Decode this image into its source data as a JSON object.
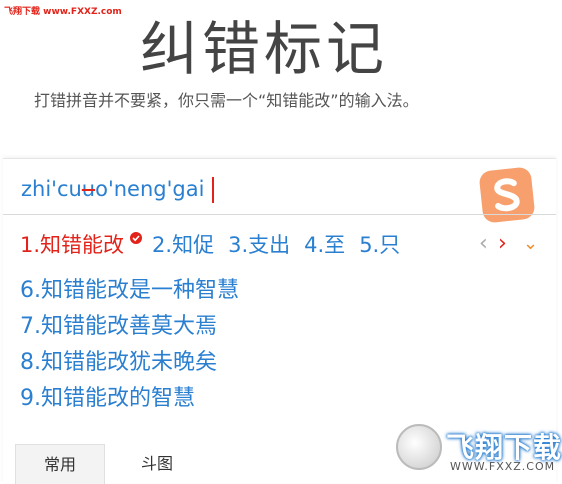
{
  "watermark_top": "飞翔下载 www.FXXZ.com",
  "title": "纠错标记",
  "subtitle": "打错拼音并不要紧，你只需一个“知错能改”的输入法。",
  "ime": {
    "pinyin": {
      "before": "zhi'cu",
      "struck": "u",
      "after": "o'neng'gai"
    },
    "logo_icon": "sogou-s-logo",
    "candidates": [
      {
        "label": "1.知错能改",
        "selected": true
      },
      {
        "label": "2.知促"
      },
      {
        "label": "3.支出"
      },
      {
        "label": "4.至"
      },
      {
        "label": "5.只"
      }
    ],
    "nav": {
      "prev": "‹",
      "next": "›",
      "expand": "⌄"
    },
    "list": [
      "6.知错能改是一种智慧",
      "7.知错能改善莫大焉",
      "8.知错能改犹未晚矣",
      "9.知错能改的智慧"
    ],
    "tabs": [
      {
        "label": "常用",
        "active": true
      },
      {
        "label": "斗图",
        "active": false
      }
    ]
  },
  "watermark_bottom": {
    "text": "飞翔下载",
    "url": "WWW.FXXZ.COM"
  },
  "colors": {
    "accent_blue": "#2a7fd0",
    "accent_red": "#e2231a",
    "logo_orange": "#f7a06d"
  }
}
